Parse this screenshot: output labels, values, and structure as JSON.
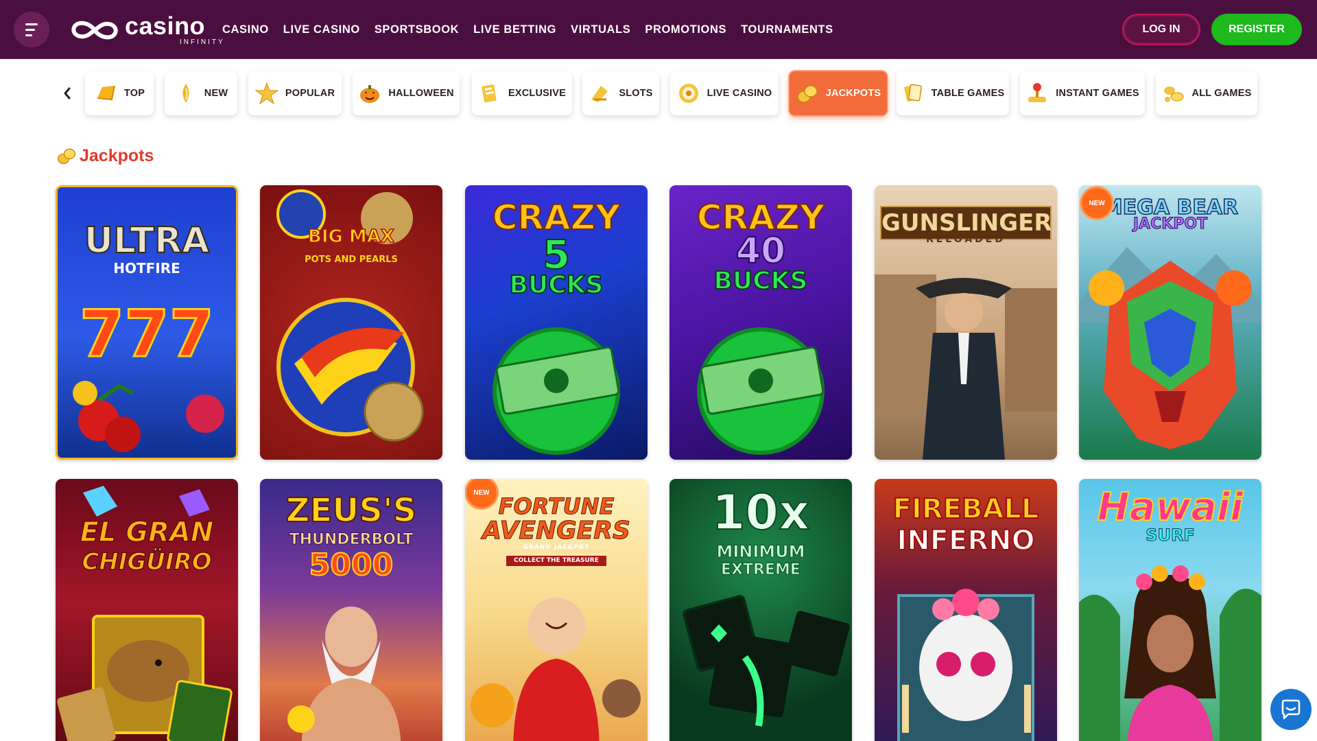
{
  "header": {
    "logo_main": "casino",
    "logo_sub": "INFINITY",
    "nav": [
      "CASINO",
      "LIVE CASINO",
      "SPORTSBOOK",
      "LIVE BETTING",
      "VIRTUALS",
      "PROMOTIONS",
      "TOURNAMENTS"
    ],
    "login_label": "LOG IN",
    "register_label": "REGISTER"
  },
  "categories": [
    {
      "label": "TOP",
      "icon": "top-icon",
      "active": false
    },
    {
      "label": "NEW",
      "icon": "new-icon",
      "active": false
    },
    {
      "label": "POPULAR",
      "icon": "star-icon",
      "active": false
    },
    {
      "label": "HALLOWEEN",
      "icon": "pumpkin-icon",
      "active": false
    },
    {
      "label": "EXCLUSIVE",
      "icon": "exclusive-icon",
      "active": false
    },
    {
      "label": "SLOTS",
      "icon": "slots-icon",
      "active": false
    },
    {
      "label": "LIVE CASINO",
      "icon": "live-casino-icon",
      "active": false
    },
    {
      "label": "JACKPOTS",
      "icon": "coins-icon",
      "active": true
    },
    {
      "label": "TABLE GAMES",
      "icon": "cards-icon",
      "active": false
    },
    {
      "label": "INSTANT GAMES",
      "icon": "joystick-icon",
      "active": false
    },
    {
      "label": "ALL GAMES",
      "icon": "all-games-icon",
      "active": false
    }
  ],
  "section": {
    "title": "Jackpots"
  },
  "games": [
    {
      "title_line1": "ULTRA",
      "title_line2": "HOTFIRE",
      "title_line3": "777",
      "new": false
    },
    {
      "title_line1": "BIG MAX",
      "title_line2": "POTS AND PEARLS",
      "title_line3": "",
      "new": false
    },
    {
      "title_line1": "CRAZY",
      "title_line2": "5",
      "title_line3": "BUCKS",
      "new": false
    },
    {
      "title_line1": "CRAZY",
      "title_line2": "40",
      "title_line3": "BUCKS",
      "new": false
    },
    {
      "title_line1": "GUNSLINGER",
      "title_line2": "RELOADED",
      "title_line3": "",
      "new": false
    },
    {
      "title_line1": "MEGA BEAR",
      "title_line2": "JACKPOT",
      "title_line3": "",
      "new": true
    },
    {
      "title_line1": "EL GRAN",
      "title_line2": "CHIGÜIRO",
      "title_line3": "",
      "new": false
    },
    {
      "title_line1": "ZEUS'S",
      "title_line2": "THUNDERBOLT",
      "title_line3": "5000",
      "new": false
    },
    {
      "title_line1": "FORTUNE",
      "title_line2": "AVENGERS",
      "title_line3": "GRAND JACKPOT",
      "title_line4": "COLLECT THE TREASURE",
      "new": true
    },
    {
      "title_line1": "10x",
      "title_line2": "MINIMUM",
      "title_line3": "EXTREME",
      "new": false
    },
    {
      "title_line1": "FIREBALL",
      "title_line2": "INFERNO",
      "title_line3": "",
      "new": false
    },
    {
      "title_line1": "Hawaii",
      "title_line2": "SURF",
      "title_line3": "",
      "new": false
    }
  ],
  "badge_new_label": "NEW",
  "colors": {
    "header": "#4a0f3f",
    "accent": "#f26b3a",
    "register": "#1db91d",
    "section_title": "#e23b2b"
  }
}
